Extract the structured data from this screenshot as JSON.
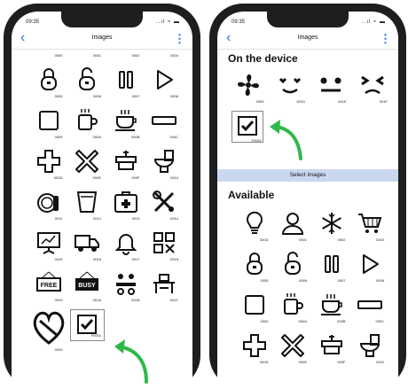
{
  "left_phone": {
    "status": {
      "time": "09:35",
      "icons": "..ıl ≈ ▬"
    },
    "nav": {
      "title": "Images"
    },
    "partial_row": [
      "0000",
      "0001",
      "0002",
      "0004"
    ],
    "rows": [
      [
        "0005",
        "0006",
        "0007",
        "0008"
      ],
      [
        "0009",
        "000A",
        "000B",
        "000C"
      ],
      [
        "000D",
        "000E",
        "000F",
        "0010"
      ],
      [
        "0011",
        "0012",
        "0013",
        "0014"
      ],
      [
        "0015",
        "0016",
        "0017",
        "0018"
      ],
      [
        "0019",
        "001A",
        "001B",
        "001C"
      ],
      [
        "0020",
        "F0001"
      ]
    ],
    "free_label": "FREE",
    "busy_label": "BUSY"
  },
  "right_phone": {
    "status": {
      "time": "09:35",
      "icons": "..ıl ≈ ▬"
    },
    "nav": {
      "title": "Images"
    },
    "section_device": "On the device",
    "device_codes": [
      "0003",
      "001D",
      "001E",
      "001F"
    ],
    "device_selected_code": "F0001",
    "select_button": "Select images",
    "section_available": "Available",
    "rows": [
      [
        "000D",
        "0001",
        "0002",
        "0004"
      ],
      [
        "0005",
        "0006",
        "0007",
        "0008"
      ],
      [
        "0009",
        "000A",
        "000B",
        "000C"
      ],
      [
        "000D",
        "000E",
        "000F",
        "0010"
      ]
    ]
  },
  "colors": {
    "accent": "#1a73e8",
    "arrow": "#2db84a",
    "select_bg": "#c9d8f0"
  }
}
